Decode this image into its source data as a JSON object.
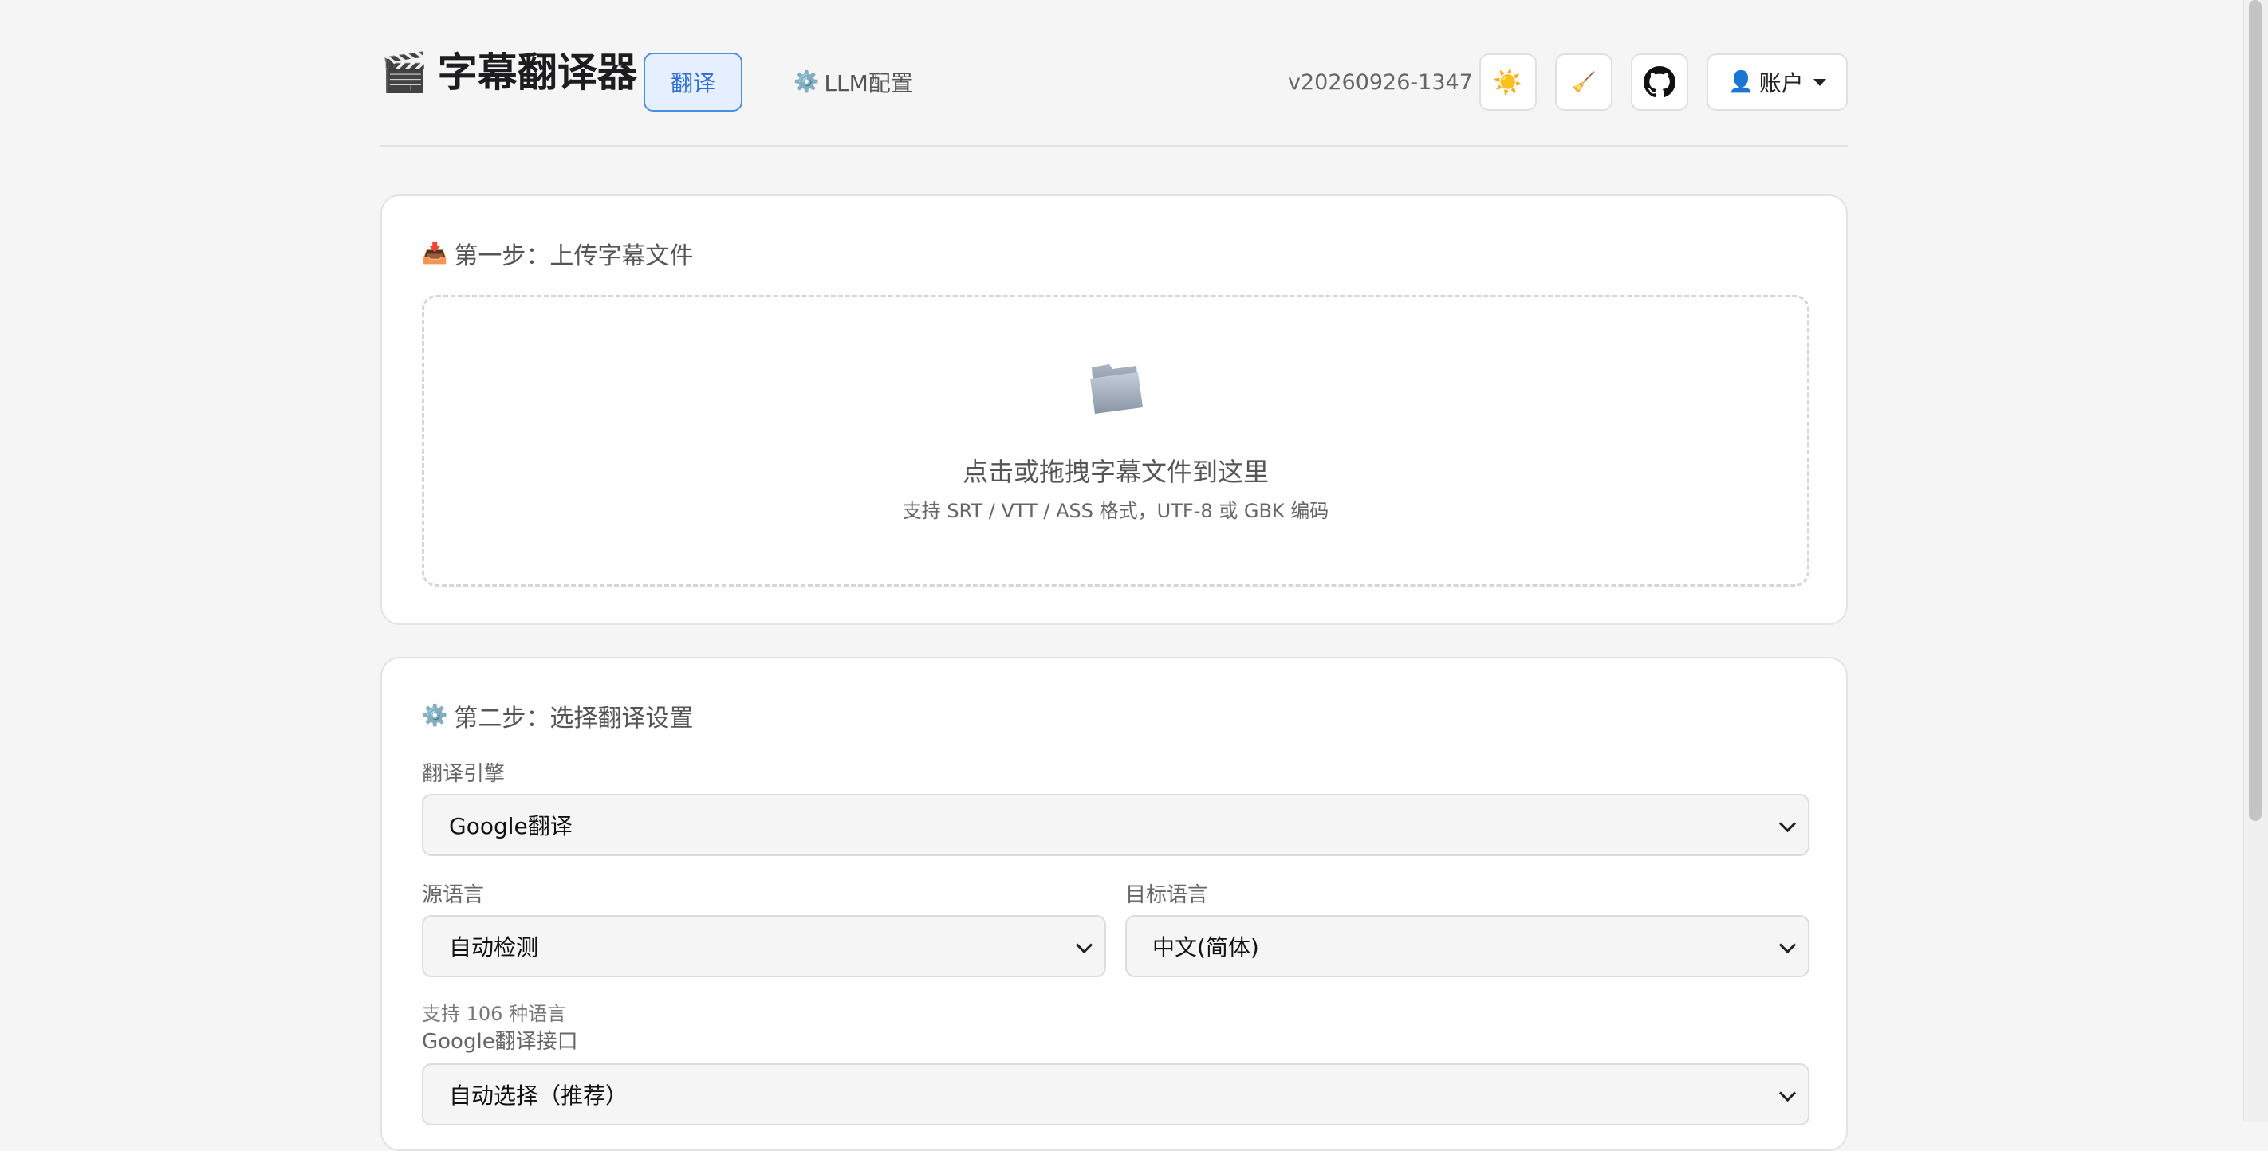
{
  "header": {
    "app_icon": "clapperboard-icon",
    "app_title": "字幕翻译器",
    "tab_translate": "翻译",
    "tab_llm_icon": "gear-icon",
    "tab_llm": "LLM配置",
    "version": "v20260926-1347",
    "theme_icon": "sun-icon",
    "clean_icon": "broom-icon",
    "github_icon": "github-icon",
    "account_icon": "user-icon",
    "account_label": "账户"
  },
  "step1": {
    "icon": "inbox-tray-icon",
    "title": "第一步：上传字幕文件",
    "dropzone_main": "点击或拖拽字幕文件到这里",
    "dropzone_sub": "支持 SRT / VTT / ASS 格式，UTF-8 或 GBK 编码"
  },
  "step2": {
    "icon": "gear-icon",
    "title": "第二步：选择翻译设置",
    "engine_label": "翻译引擎",
    "engine_value": "Google翻译",
    "source_label": "源语言",
    "source_value": "自动检测",
    "target_label": "目标语言",
    "target_value": "中文(简体)",
    "languages_hint": "支持 106 种语言",
    "api_label": "Google翻译接口",
    "api_value": "自动选择（推荐）"
  },
  "colors": {
    "accent": "#4a90e2",
    "accent_bg": "#e6efff",
    "page_bg": "#f5f5f5"
  }
}
